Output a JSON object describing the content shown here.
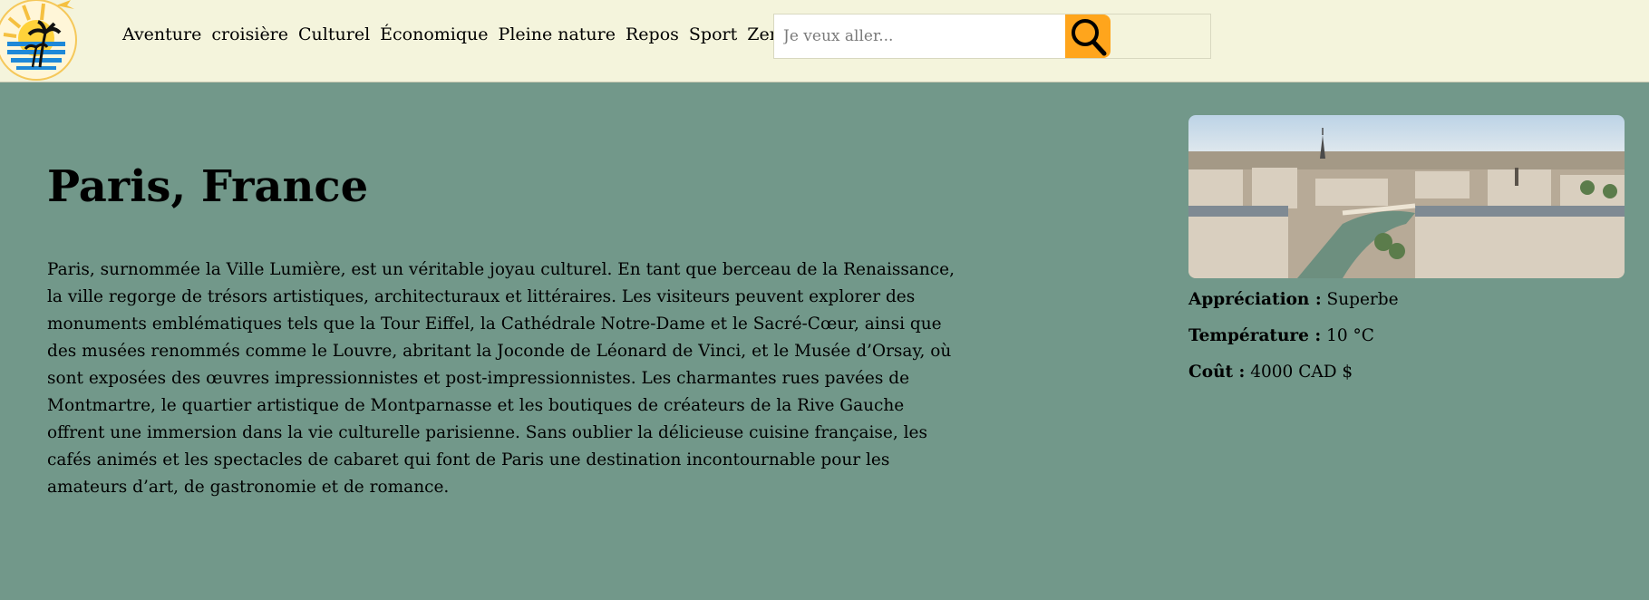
{
  "nav": {
    "items": [
      {
        "label": "Aventure"
      },
      {
        "label": "croisière"
      },
      {
        "label": "Culturel"
      },
      {
        "label": "Économique"
      },
      {
        "label": "Pleine nature"
      },
      {
        "label": "Repos"
      },
      {
        "label": "Sport"
      },
      {
        "label": "Zen"
      }
    ]
  },
  "search": {
    "placeholder": "Je veux aller...",
    "value": ""
  },
  "destination": {
    "title": "Paris, France",
    "description": "Paris, surnommée la Ville Lumière, est un véritable joyau culturel. En tant que berceau de la Renaissance, la ville regorge de trésors artistiques, architecturaux et littéraires. Les visiteurs peuvent explorer des monuments emblématiques tels que la Tour Eiffel, la Cathédrale Notre-Dame et le Sacré-Cœur, ainsi que des musées renommés comme le Louvre, abritant la Joconde de Léonard de Vinci, et le Musée d’Orsay, où sont exposées des œuvres impressionnistes et post-impressionnistes. Les charmantes rues pavées de Montmartre, le quartier artistique de Montparnasse et les boutiques de créateurs de la Rive Gauche offrent une immersion dans la vie culturelle parisienne. Sans oublier la délicieuse cuisine française, les cafés animés et les spectacles de cabaret qui font de Paris une destination incontournable pour les amateurs d’art, de gastronomie et de romance.",
    "appreciation_label": "Appréciation :",
    "appreciation_value": "Superbe",
    "temperature_label": "Température :",
    "temperature_value": "10 °C",
    "cost_label": "Coût :",
    "cost_value": "4000 CAD $"
  },
  "colors": {
    "navbar_bg": "#f4f4dc",
    "page_bg": "#72988a",
    "search_button": "#ffa51c"
  },
  "icons": {
    "logo": "sun-palm-logo-icon",
    "search": "magnifier-icon"
  }
}
